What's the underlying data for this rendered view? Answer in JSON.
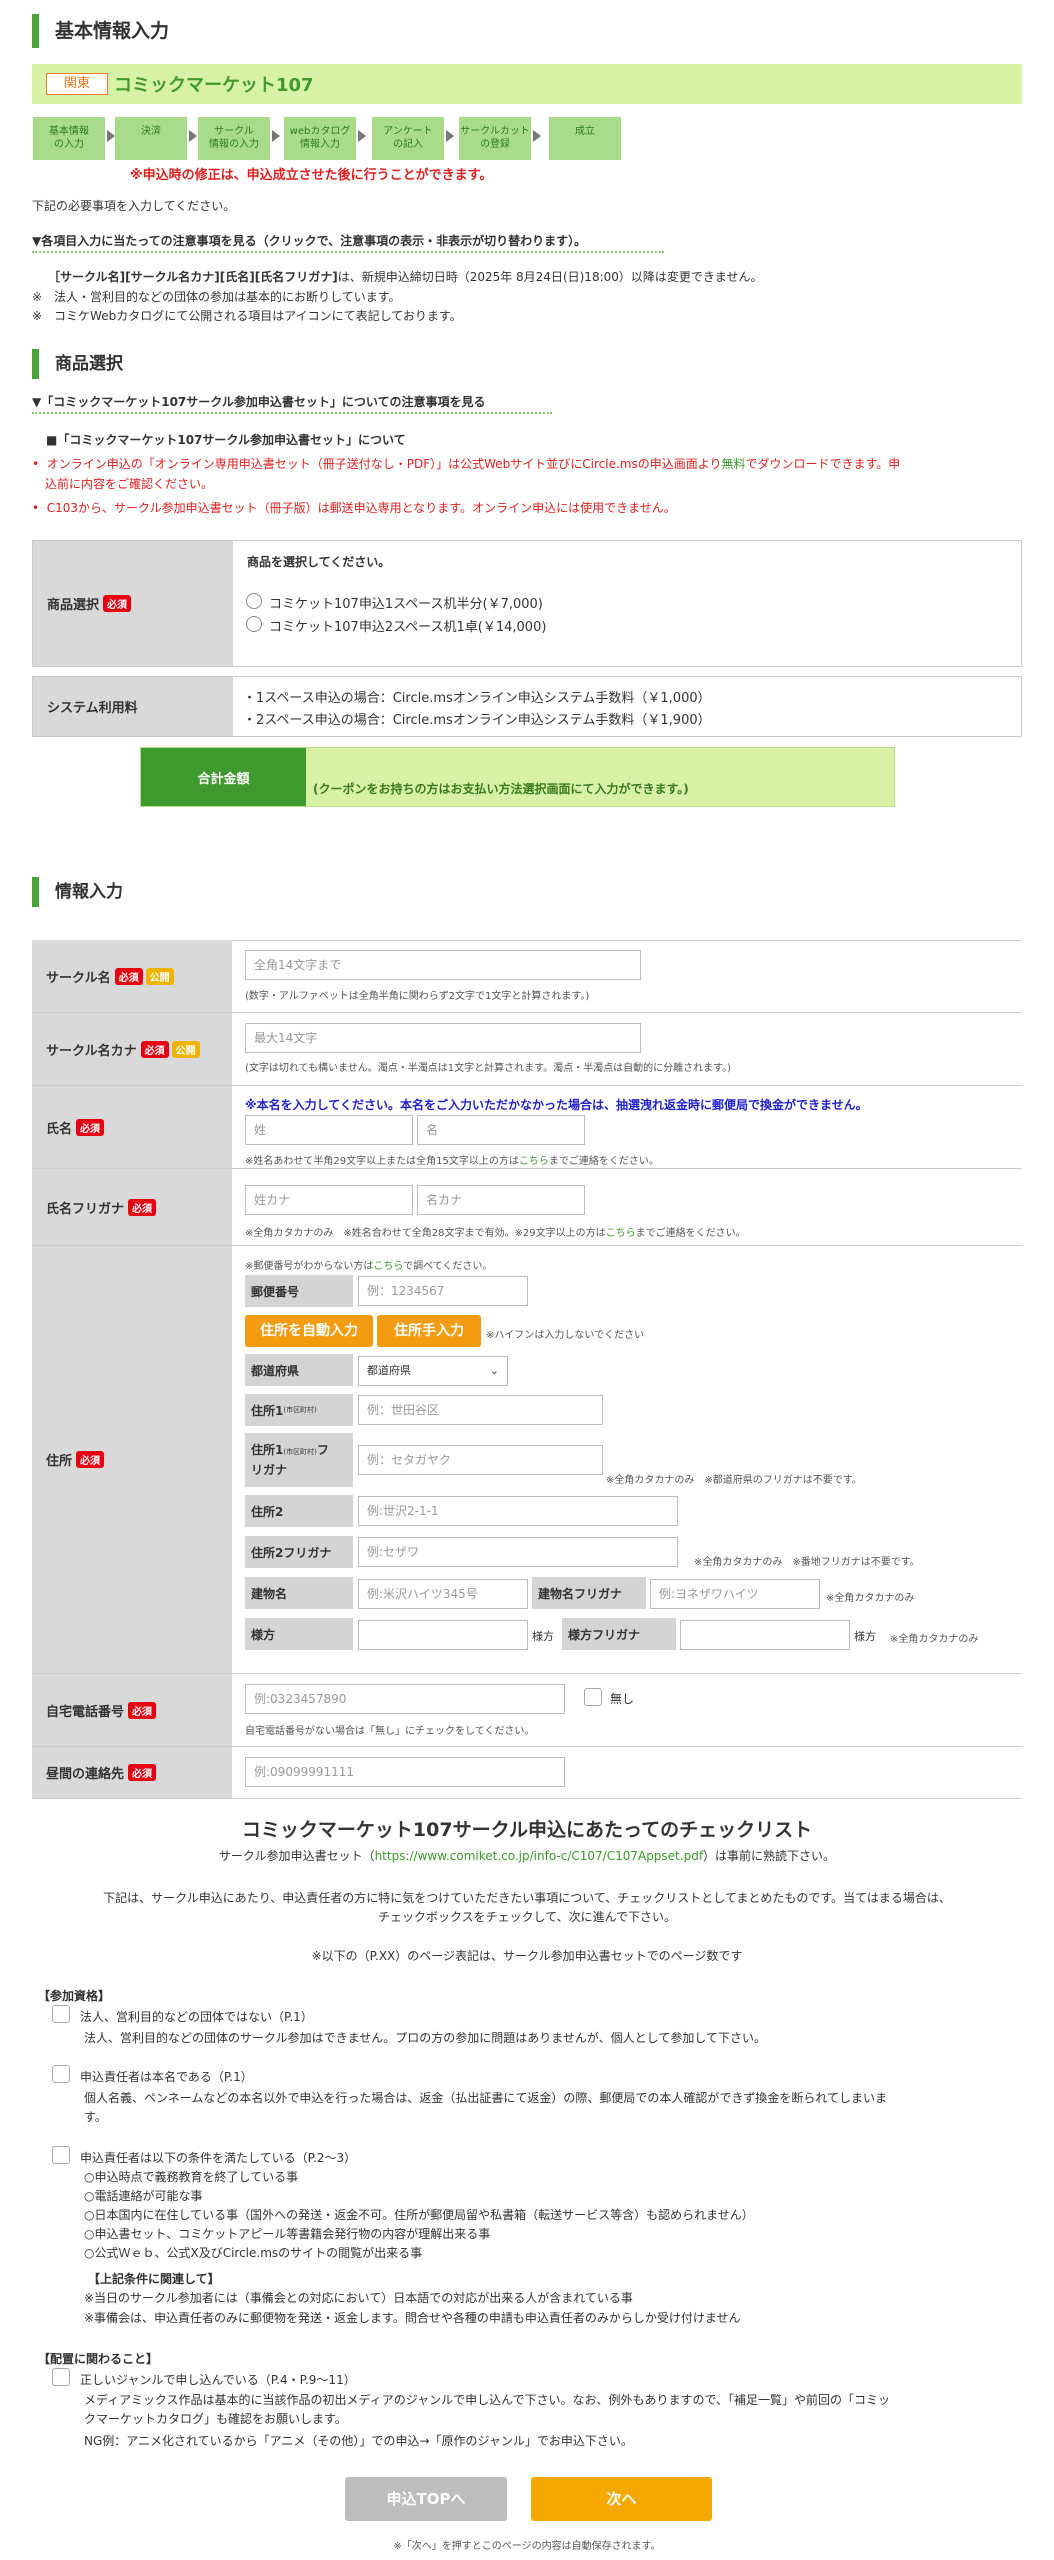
{
  "page_title": "基本情報入力",
  "event": {
    "region": "関東",
    "name": "コミックマーケット107"
  },
  "steps": [
    "基本情報\nの入力",
    "決済",
    "サークル\n情報の入力",
    "webカタログ\n情報入力",
    "アンケート\nの記入",
    "サークルカット\nの登録",
    "成立"
  ],
  "modify_note": "※申込時の修正は、申込成立させた後に行うことができます。",
  "intro": "下記の必要事項を入力してください。",
  "caution_toggle": "▼各項目入力に当たっての注意事項を見る（クリックで、注意事項の表示・非表示が切り替わります）。",
  "notes": {
    "n1a": "［サークル名][サークル名カナ][氏名][氏名フリガナ]",
    "n1b": "は、新規申込締切日時（2025年 8月24日(日)18:00）以降は変更できません。",
    "n2": "※　法人・営利目的などの団体の参加は基本的にお断りしています。",
    "n3": "※　コミケWebカタログにて公開される項目はアイコンにて表記しております。"
  },
  "product": {
    "heading": "商品選択",
    "toggle": "▼「コミックマーケット107サークル参加申込書セット」についての注意事項を見る",
    "box_title": "■「コミックマーケット107サークル参加申込書セット」について",
    "b1a": "オンライン申込の「オンライン専用申込書セット（冊子送付なし・PDF）」は公式Webサイト並びにCircle.msの申込画面より",
    "b1b": "無料",
    "b1c": "でダウンロードできます。申",
    "b1d": "込前に内容をご確認ください。",
    "b2": "C103から、サークル参加申込書セット（冊子版）は郵送申込専用となります。オンライン申込には使用できません。",
    "label": "商品選択",
    "prompt": "商品を選択してください。",
    "opt1": "コミケット107申込1スペース机半分(￥7,000)",
    "opt2": "コミケット107申込2スペース机1卓(￥14,000)",
    "fee_label": "システム利用料",
    "fee1": "・1スペース申込の場合：Circle.msオンライン申込システム手数料（￥1,000）",
    "fee2": "・2スペース申込の場合：Circle.msオンライン申込システム手数料（￥1,900）",
    "total_label": "合計金額",
    "total_note": "(クーポンをお持ちの方はお支払い方法選択画面にて入力ができます。)"
  },
  "info": {
    "heading": "情報入力",
    "req": "必須",
    "pub": "公開",
    "circle_name": {
      "label": "サークル名",
      "placeholder": "全角14文字まで",
      "note": "(数字・アルファベットは全角半角に関わらず2文字で1文字と計算されます。)"
    },
    "circle_kana": {
      "label": "サークル名カナ",
      "placeholder": "最大14文字",
      "note": "(文字は切れても構いません。濁点・半濁点は1文字と計算されます。濁点・半濁点は自動的に分離されます。)"
    },
    "name": {
      "label": "氏名",
      "warn": "※本名を入力してください。本名をご入力いただかなかった場合は、抽選洩れ返金時に郵便局で換金ができません。",
      "ph_last": "姓",
      "ph_first": "名",
      "note_a": "※姓名あわせて半角29文字以上または全角15文字以上の方は",
      "note_link": "こちら",
      "note_b": "までご連絡をください。"
    },
    "furigana": {
      "label": "氏名フリガナ",
      "ph_last": "姓カナ",
      "ph_first": "名カナ",
      "note_a": "※全角カタカナのみ　※姓名合わせて全角28文字まで有効。※29文字以上の方は",
      "note_link": "こちら",
      "note_b": "までご連絡をください。"
    },
    "address": {
      "label": "住所",
      "top_a": "※郵便番号がわからない方は",
      "top_link": "こちら",
      "top_b": "で調べてください。",
      "zip_label": "郵便番号",
      "zip_ph": "例：1234567",
      "auto_btn": "住所を自動入力",
      "manual_btn": "住所手入力",
      "hyphen_note": "※ハイフンは入力しないでください",
      "pref_label": "都道府県",
      "pref_value": "都道府県",
      "addr1_label": "住所1",
      "addr1_sub": "(市区町村)",
      "addr1_ph": "例：世田谷区",
      "addr1k_label": "住所1",
      "addr1k_sub": "(市区町村)",
      "addr1k_label2": "フ",
      "addr1k_label3": "リガナ",
      "addr1k_ph": "例：セタガヤク",
      "addr1k_note": "※全角カタカナのみ　※都道府県のフリガナは不要です。",
      "addr2_label": "住所2",
      "addr2_ph": "例:世沢2-1-1",
      "addr2k_label": "住所2フリガナ",
      "addr2k_ph": "例:セザワ",
      "addr2k_note": "※全角カタカナのみ　※番地フリガナは不要です。",
      "bldg_label": "建物名",
      "bldg_ph": "例:米沢ハイツ345号",
      "bldgk_label": "建物名フリガナ",
      "bldgk_ph": "例:ヨネザワハイツ",
      "bldgk_note": "※全角カタカナのみ",
      "care_label": "様方",
      "care_suffix": "様方",
      "carek_label": "様方フリガナ",
      "carek_suffix": "様方",
      "carek_note": "※全角カタカナのみ"
    },
    "home_phone": {
      "label": "自宅電話番号",
      "placeholder": "例:0323457890",
      "none": "無し",
      "note": "自宅電話番号がない場合は「無し」にチェックをしてください。"
    },
    "day_contact": {
      "label": "昼間の連絡先",
      "placeholder": "例:09099991111"
    }
  },
  "checklist": {
    "title": "コミックマーケット107サークル申込にあたってのチェックリスト",
    "sub_a": "サークル参加申込書セット（",
    "sub_link": "https://www.comiket.co.jp/info-c/C107/C107Appset.pdf",
    "sub_b": "）は事前に熟読下さい。",
    "desc1": "下記は、サークル申込にあたり、申込責任者の方に特に気をつけていただきたい事項について、チェックリストとしてまとめたものです。当てはまる場合は、",
    "desc2": "チェックボックスをチェックして、次に進んで下さい。",
    "page_note": "※以下の（P.XX）のページ表記は、サークル参加申込書セットでのページ数です",
    "sec1": "【参加資格】",
    "c1_title": "法人、営利目的などの団体ではない（P.1）",
    "c1_body": "法人、営利目的などの団体のサークル参加はできません。プロの方の参加に問題はありませんが、個人として参加して下さい。",
    "c2_title": "申込責任者は本名である（P.1）",
    "c2_body1": "個人名義、ペンネームなどの本名以外で申込を行った場合は、返金（払出証書にて返金）の際、郵便局での本人確認ができず換金を断られてしまいま",
    "c2_body2": "す。",
    "c3_title": "申込責任者は以下の条件を満たしている（P.2～3）",
    "c3_items": [
      "○申込時点で義務教育を終了している事",
      "○電話連絡が可能な事",
      "○日本国内に在住している事（国外への発送・返金不可。住所が郵便局留や私書箱（転送サービス等含）も認められません）",
      "○申込書セット、コミケットアピール等書籍会発行物の内容が理解出来る事",
      "○公式Ｗｅｂ、公式X及びCircle.msのサイトの閲覧が出来る事"
    ],
    "c3_sub": "【上記条件に関連して】",
    "c3_sub_items": [
      "※当日のサークル参加者には（事備会との対応において）日本語での対応が出来る人が含まれている事",
      "※事備会は、申込責任者のみに郵便物を発送・返金します。問合せや各種の申請も申込責任者のみからしか受け付けません"
    ],
    "sec2": "【配置に関わること】",
    "c4_title": "正しいジャンルで申し込んでいる（P.4・P.9～11）",
    "c4_body1": "メディアミックス作品は基本的に当該作品の初出メディアのジャンルで申し込んで下さい。なお、例外もありますので、「補足一覧」や前回の「コミッ",
    "c4_body2": "クマーケットカタログ」も確認をお願いします。",
    "c4_body3": "NG例：アニメ化されているから「アニメ（その他）」での申込→「原作のジャンル」でお申込下さい。"
  },
  "buttons": {
    "top": "申込TOPへ",
    "next": "次へ",
    "autosave": "※「次へ」を押すとこのページの内容は自動保存されます。"
  }
}
